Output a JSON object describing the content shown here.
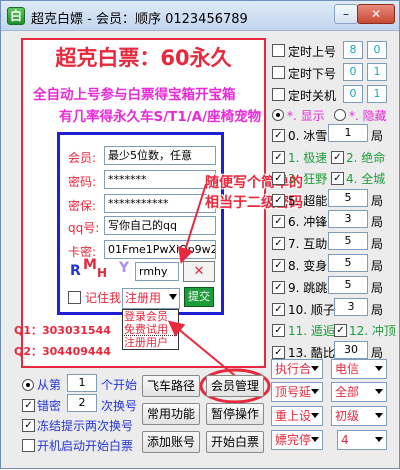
{
  "window": {
    "icon_glyph": "白",
    "title": "超克白嫖 - 会员：顺序 0123456789",
    "minimize": "–",
    "close": "✕"
  },
  "main": {
    "headline": "超克白票：60永久",
    "line1": "全自动上号参与白票得宝箱开宝箱",
    "line2": "有几率得永久车S/T1/A/座椅宠物"
  },
  "login": {
    "member_label": "会员:",
    "member_value": "最少5位数，任意",
    "password_label": "密码:",
    "password_value": "*******",
    "secpass_label": "密保:",
    "secpass_value": "***********",
    "qq_label": "qq号:",
    "qq_value": "写你自己的qq",
    "card_label": "卡密:",
    "card_value": "01Fme1PwXiOp9w2fk7",
    "logo_r": "R",
    "logo_m": "M",
    "logo_h": "H",
    "logo_y": "Y",
    "rmhy_value": "rmhy",
    "x_button": "✕",
    "remember_label": "记住我",
    "register_value": "注册用",
    "submit": "提交",
    "dropdown_options": [
      "登录会员",
      "免费试用",
      "注册用户"
    ]
  },
  "annotations": {
    "note1": "随便写个简单的",
    "note2": "相当于二级密码",
    "qq1": "Q1：303031544",
    "qq2": "Q2：304409444"
  },
  "right": {
    "timer_on_label": "定时上号",
    "timer_on_a": "8",
    "timer_on_b": "0",
    "timer_off_label": "定时下号",
    "timer_off_a": "0",
    "timer_off_b": "1",
    "timer_shutdown_label": "定时关机",
    "timer_shutdown_a": "0",
    "timer_shutdown_b": "1",
    "show_label": "*. 显示",
    "hide_label": "*. 隐藏",
    "ice_label": "0. 冰雪",
    "ice_count": "1",
    "ju": "局",
    "speed_label": "1. 极速",
    "extinct_label": "2. 绝命",
    "crazy_label": "3. 狂野",
    "city_label": "4. 全城",
    "superspeed_label": "5. 超能",
    "superspeed_count": "5",
    "charge_label": "6. 冲锋",
    "charge_count": "3",
    "assist_label": "7. 互助",
    "assist_count": "5",
    "transform_label": "8. 变身",
    "transform_count": "5",
    "jump_label": "9. 跳跳",
    "jump_count": "5",
    "order_label": "10. 顺子",
    "order_count": "3",
    "escape_label": "11. 遁逅",
    "surprise_label": "12. 冲顶",
    "cool_label": "13. 酷比",
    "cool_count": "30"
  },
  "bottom": {
    "from_label": "从第",
    "from_value": "1",
    "start_label": "个开始",
    "error_label": "错密",
    "error_value": "2",
    "switch_label": "次换号",
    "freeze_label": "冻结提示两次换号",
    "boot_label": "开机启动开始白票",
    "route_btn": "飞车路径",
    "member_btn": "会员管理",
    "common_btn": "常用功能",
    "pause_btn": "暂停操作",
    "add_btn": "添加账号",
    "start_btn": "开始白票",
    "exec_label": "执行合",
    "telecom_label": "电信",
    "delay_label": "顶号延",
    "all_label": "全部",
    "relogin_label": "重上设",
    "level_label": "初级",
    "stop_label": "嫖完停",
    "stop_value": "4"
  }
}
